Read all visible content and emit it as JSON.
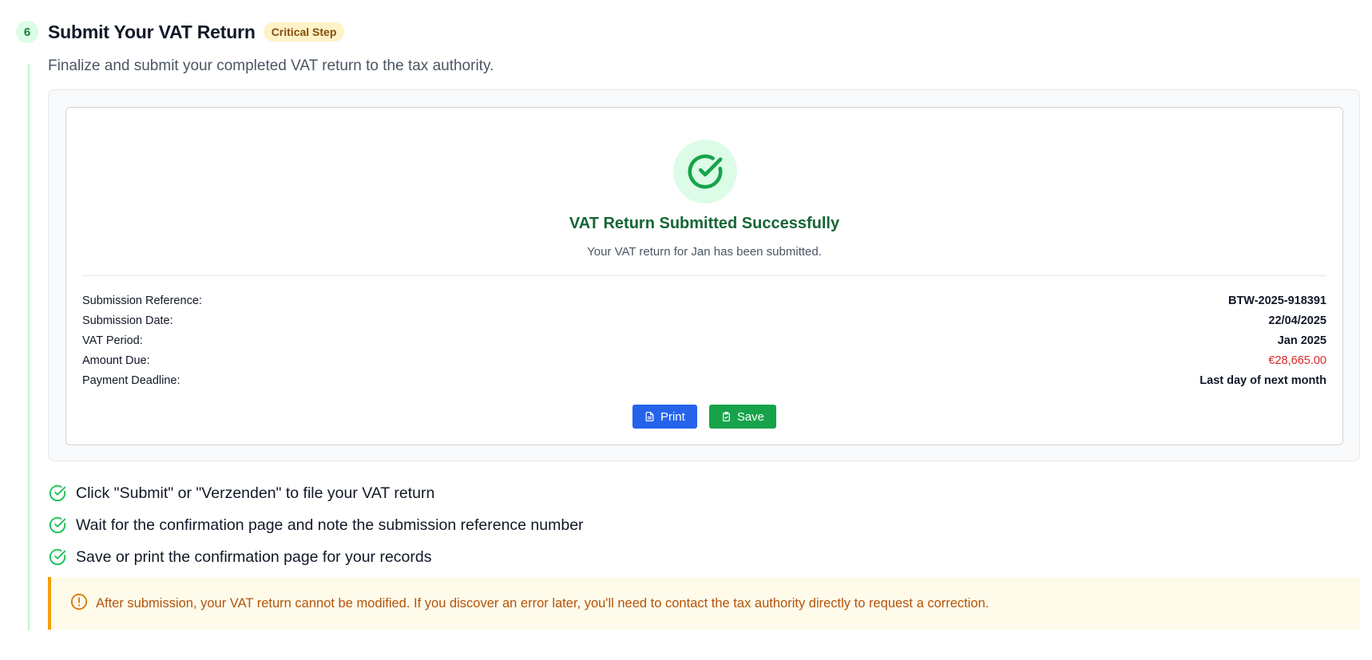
{
  "step": {
    "number": "6",
    "title": "Submit Your VAT Return",
    "badge": "Critical Step",
    "description": "Finalize and submit your completed VAT return to the tax authority."
  },
  "confirmation": {
    "icon": "check-circle-icon",
    "title": "VAT Return Submitted Successfully",
    "subtitle": "Your VAT return for Jan has been submitted.",
    "details": [
      {
        "label": "Submission Reference:",
        "value": "BTW-2025-918391"
      },
      {
        "label": "Submission Date:",
        "value": "22/04/2025"
      },
      {
        "label": "VAT Period:",
        "value": "Jan 2025"
      },
      {
        "label": "Amount Due:",
        "value": "€28,665.00"
      },
      {
        "label": "Payment Deadline:",
        "value": "Last day of next month"
      }
    ],
    "buttons": {
      "print_label": "Print",
      "print_icon": "document-icon",
      "save_label": "Save",
      "save_icon": "clipboard-check-icon"
    }
  },
  "checklist": [
    "Click \"Submit\" or \"Verzenden\" to file your VAT return",
    "Wait for the confirmation page and note the submission reference number",
    "Save or print the confirmation page for your records"
  ],
  "warning": {
    "icon": "alert-circle-icon",
    "text": "After submission, your VAT return cannot be modified. If you discover an error later, you'll need to contact the tax authority directly to request a correction."
  },
  "colors": {
    "accent_green": "#16a34a",
    "accent_blue": "#2563eb",
    "amount_due": "#dc2626",
    "warning": "#f59e0b"
  }
}
